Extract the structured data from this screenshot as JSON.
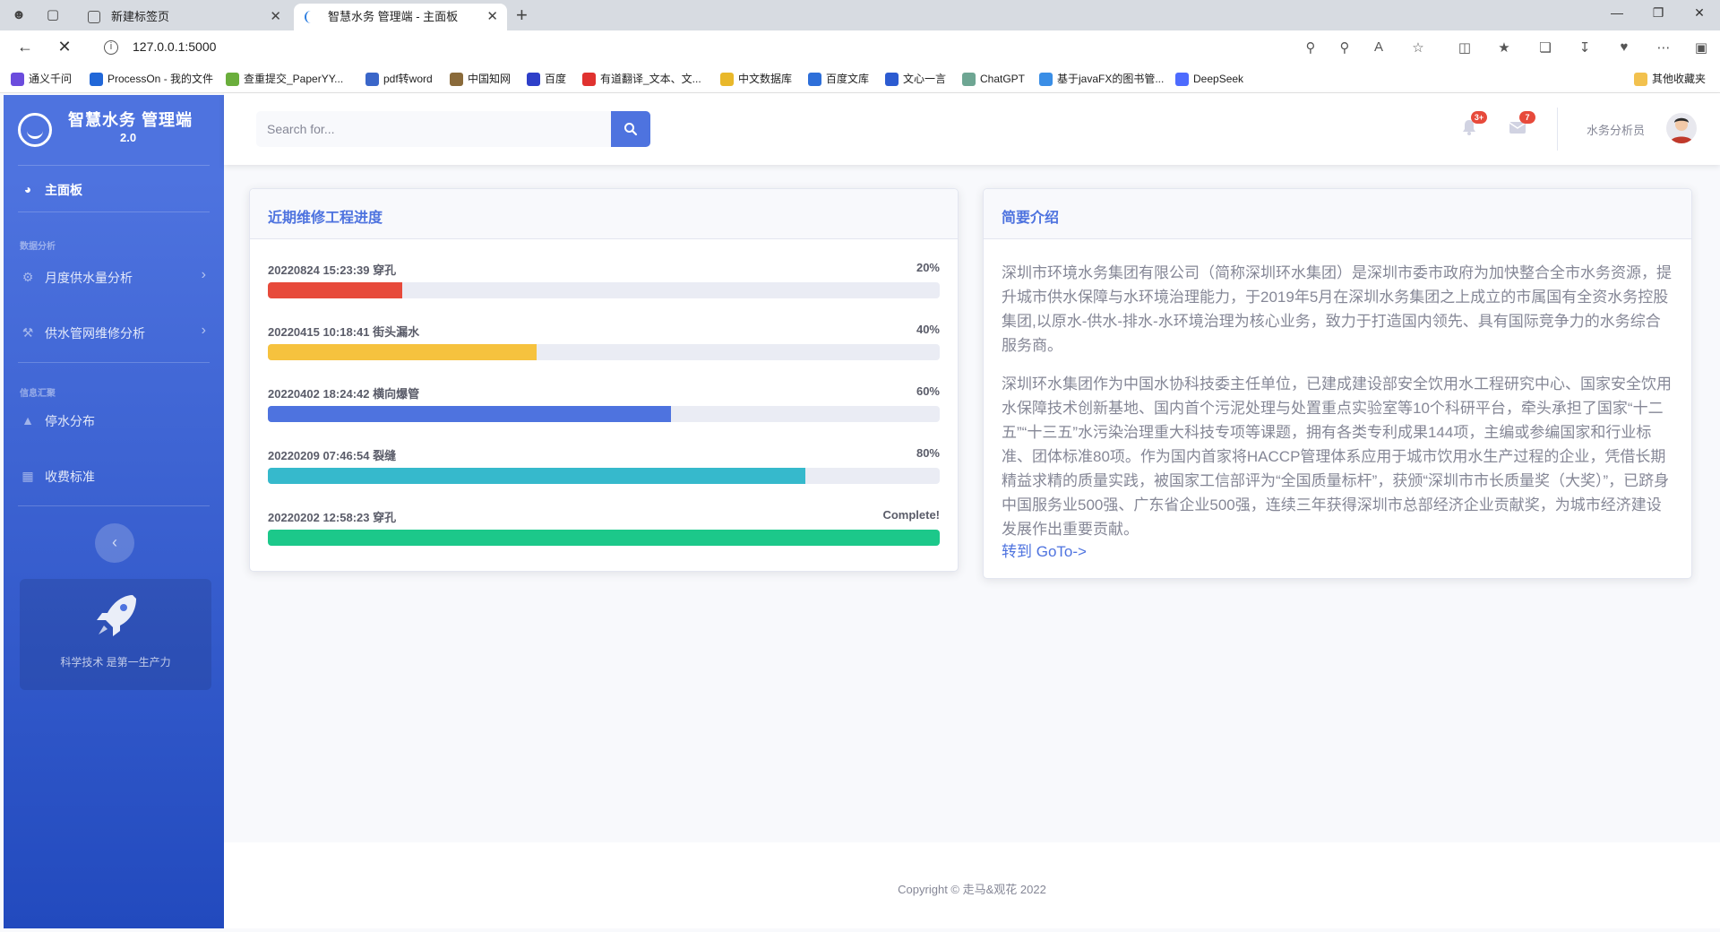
{
  "browser": {
    "tabs": [
      {
        "label": "新建标签页"
      },
      {
        "label": "智慧水务 管理端 - 主面板"
      }
    ],
    "url": "127.0.0.1:5000",
    "bookmarks": [
      {
        "label": "通义千问",
        "color": "#6b4cdd"
      },
      {
        "label": "ProcessOn - 我的文件",
        "color": "#2167d8"
      },
      {
        "label": "查重提交_PaperYY...",
        "color": "#6aae3c"
      },
      {
        "label": "pdf转word",
        "color": "#3a66c9"
      },
      {
        "label": "中国知网",
        "color": "#8a6a3a"
      },
      {
        "label": "百度",
        "color": "#2e3fc9"
      },
      {
        "label": "有道翻译_文本、文...",
        "color": "#e0322f"
      },
      {
        "label": "中文数据库",
        "color": "#e9b82a"
      },
      {
        "label": "百度文库",
        "color": "#2e6fd9"
      },
      {
        "label": "文心一言",
        "color": "#2c5bd1"
      },
      {
        "label": "ChatGPT",
        "color": "#6ea693"
      },
      {
        "label": "基于javaFX的图书管...",
        "color": "#3a8ee6"
      },
      {
        "label": "DeepSeek",
        "color": "#4d6bfe"
      }
    ],
    "bookmarks_folder": "其他收藏夹"
  },
  "sidebar": {
    "brand_title": "智慧水务 管理端",
    "brand_version": "2.0",
    "dashboard": "主面板",
    "heading_analysis": "数据分析",
    "items_analysis": [
      {
        "label": "月度供水量分析",
        "icon": "gear-icon"
      },
      {
        "label": "供水管网维修分析",
        "icon": "wrench-icon"
      }
    ],
    "heading_summary": "信息汇聚",
    "items_summary": [
      {
        "label": "停水分布",
        "icon": "chart-area-icon"
      },
      {
        "label": "收费标准",
        "icon": "table-icon"
      }
    ],
    "promo_text": "科学技术 是第一生产力"
  },
  "topbar": {
    "search_placeholder": "Search for...",
    "alerts_count": "3+",
    "messages_count": "7",
    "user_name": "水务分析员"
  },
  "progress_card": {
    "title": "近期维修工程进度",
    "items": [
      {
        "label": "20220824 15:23:39 穿孔",
        "value_text": "20%",
        "percent": 20,
        "color": "#e74a3b"
      },
      {
        "label": "20220415 10:18:41 街头漏水",
        "value_text": "40%",
        "percent": 40,
        "color": "#f6c23e"
      },
      {
        "label": "20220402 18:24:42 横向爆管",
        "value_text": "60%",
        "percent": 60,
        "color": "#4e73df"
      },
      {
        "label": "20220209 07:46:54 裂缝",
        "value_text": "80%",
        "percent": 80,
        "color": "#36b9cc"
      },
      {
        "label": "20220202 12:58:23 穿孔",
        "value_text": "Complete!",
        "percent": 100,
        "color": "#1cc88a"
      }
    ]
  },
  "intro_card": {
    "title": "简要介绍",
    "paragraph1": "深圳市环境水务集团有限公司（简称深圳环水集团）是深圳市委市政府为加快整合全市水务资源，提升城市供水保障与水环境治理能力，于2019年5月在深圳水务集团之上成立的市属国有全资水务控股集团,以原水-供水-排水-水环境治理为核心业务，致力于打造国内领先、具有国际竞争力的水务综合服务商。",
    "paragraph2": "深圳环水集团作为中国水协科技委主任单位，已建成建设部安全饮用水工程研究中心、国家安全饮用水保障技术创新基地、国内首个污泥处理与处置重点实验室等10个科研平台，牵头承担了国家“十二五”“十三五”水污染治理重大科技专项等课题，拥有各类专利成果144项，主编或参编国家和行业标准、团体标准80项。作为国内首家将HACCP管理体系应用于城市饮用水生产过程的企业，凭借长期精益求精的质量实践，被国家工信部评为“全国质量标杆”，获颁“深圳市市长质量奖（大奖）”，已跻身中国服务业500强、广东省企业500强，连续三年获得深圳市总部经济企业贡献奖，为城市经济建设发展作出重要贡献。",
    "link": "转到 GoTo->"
  },
  "footer": {
    "copyright": "Copyright © 走马&观花 2022"
  }
}
